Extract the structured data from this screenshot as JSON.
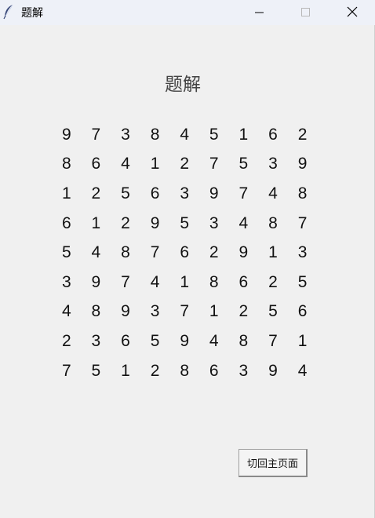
{
  "window": {
    "title": "题解",
    "icon": "feather-icon",
    "controls": [
      "minimize-icon",
      "maximize-icon",
      "close-icon"
    ]
  },
  "page": {
    "title": "题解"
  },
  "sudoku": {
    "rows": [
      [
        "9",
        "7",
        "3",
        "8",
        "4",
        "5",
        "1",
        "6",
        "2"
      ],
      [
        "8",
        "6",
        "4",
        "1",
        "2",
        "7",
        "5",
        "3",
        "9"
      ],
      [
        "1",
        "2",
        "5",
        "6",
        "3",
        "9",
        "7",
        "4",
        "8"
      ],
      [
        "6",
        "1",
        "2",
        "9",
        "5",
        "3",
        "4",
        "8",
        "7"
      ],
      [
        "5",
        "4",
        "8",
        "7",
        "6",
        "2",
        "9",
        "1",
        "3"
      ],
      [
        "3",
        "9",
        "7",
        "4",
        "1",
        "8",
        "6",
        "2",
        "5"
      ],
      [
        "4",
        "8",
        "9",
        "3",
        "7",
        "1",
        "2",
        "5",
        "6"
      ],
      [
        "2",
        "3",
        "6",
        "5",
        "9",
        "4",
        "8",
        "7",
        "1"
      ],
      [
        "7",
        "5",
        "1",
        "2",
        "8",
        "6",
        "3",
        "9",
        "4"
      ]
    ]
  },
  "actions": {
    "back_label": "切回主页面"
  }
}
